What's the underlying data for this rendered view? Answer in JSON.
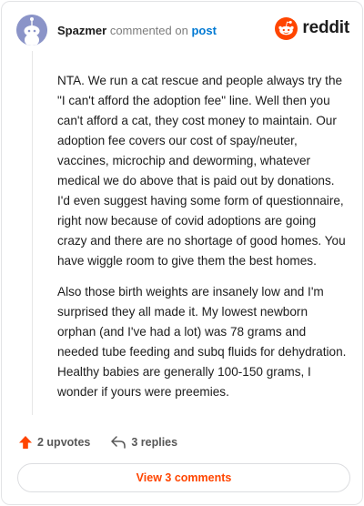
{
  "comment": {
    "username": "Spazmer",
    "verb": "commented on",
    "target": "post",
    "paragraphs": [
      "NTA. We run a cat rescue and people always try the \"I can't afford the adoption fee\" line. Well then you can't afford a cat, they cost money to maintain. Our adoption fee covers our cost of spay/neuter, vaccines, microchip and deworming, whatever medical we do above that is paid out by donations. I'd even suggest having some form of questionnaire, right now because of covid adoptions are going crazy and there are no shortage of good homes. You have wiggle room to give them the best homes.",
      "Also those birth weights are insanely low and I'm surprised they all made it. My lowest newborn orphan (and I've had a lot) was 78 grams and needed tube feeding and subq fluids for dehydration. Healthy babies are generally 100-150 grams, I wonder if yours were preemies."
    ],
    "upvotes_label": "2 upvotes",
    "replies_label": "3 replies",
    "view_comments_label": "View 3 comments"
  },
  "brand": {
    "name": "reddit",
    "accent": "#ff4500"
  },
  "icons": {
    "avatar": "snoo-avatar",
    "logo": "reddit-logo-icon",
    "upvote": "upvote-arrow-icon",
    "reply": "reply-arrow-icon"
  },
  "colors": {
    "link": "#0079d3",
    "accent": "#ff4500",
    "avatar_bg": "#8b94c8"
  }
}
